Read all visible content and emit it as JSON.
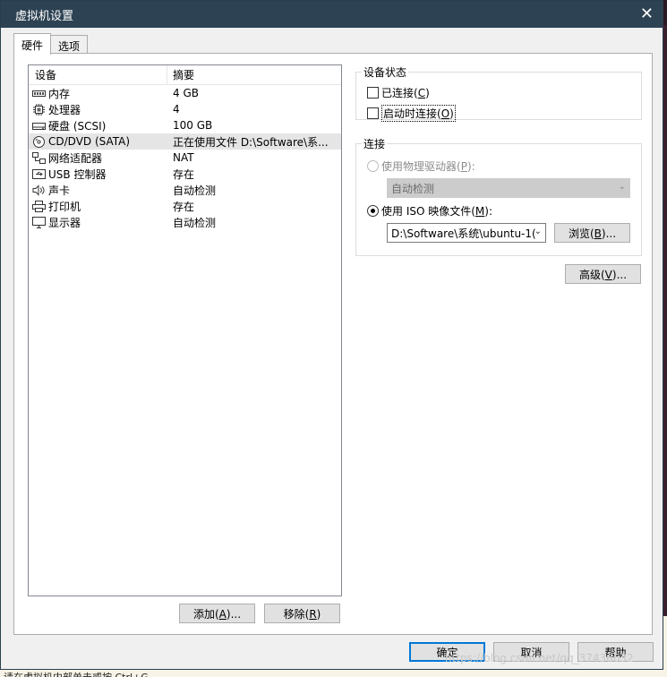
{
  "window": {
    "title": "虚拟机设置"
  },
  "tabs": [
    {
      "label": "硬件"
    },
    {
      "label": "选项"
    }
  ],
  "device_list": {
    "headers": {
      "device": "设备",
      "summary": "摘要"
    },
    "rows": [
      {
        "icon": "memory-icon",
        "name": "内存",
        "summary": "4 GB"
      },
      {
        "icon": "processor-icon",
        "name": "处理器",
        "summary": "4"
      },
      {
        "icon": "harddisk-icon",
        "name": "硬盘 (SCSI)",
        "summary": "100 GB"
      },
      {
        "icon": "cdrom-icon",
        "name": "CD/DVD (SATA)",
        "summary": "正在使用文件 D:\\Software\\系..."
      },
      {
        "icon": "network-icon",
        "name": "网络适配器",
        "summary": "NAT"
      },
      {
        "icon": "usb-icon",
        "name": "USB 控制器",
        "summary": "存在"
      },
      {
        "icon": "sound-icon",
        "name": "声卡",
        "summary": "自动检测"
      },
      {
        "icon": "printer-icon",
        "name": "打印机",
        "summary": "存在"
      },
      {
        "icon": "display-icon",
        "name": "显示器",
        "summary": "自动检测"
      }
    ],
    "selected_index": 3
  },
  "list_buttons": {
    "add": "添加(A)...",
    "remove": "移除(R)"
  },
  "device_status": {
    "title": "设备状态",
    "connected": "已连接(C)",
    "connect_on_power_on": "启动时连接(O)"
  },
  "connection": {
    "title": "连接",
    "physical_drive": "使用物理驱动器(P):",
    "physical_drive_value": "自动检测",
    "iso_file": "使用 ISO 映像文件(M):",
    "iso_path": "D:\\Software\\系统\\ubuntu-1(",
    "browse": "浏览(B)..."
  },
  "advanced_button": "高级(V)...",
  "footer": {
    "ok": "确定",
    "cancel": "取消",
    "help": "帮助"
  },
  "watermark": "https://blog.csdn.net/qq_37436632",
  "background_status_text": "请在虚拟机内部单击或按 Ctrl+G"
}
